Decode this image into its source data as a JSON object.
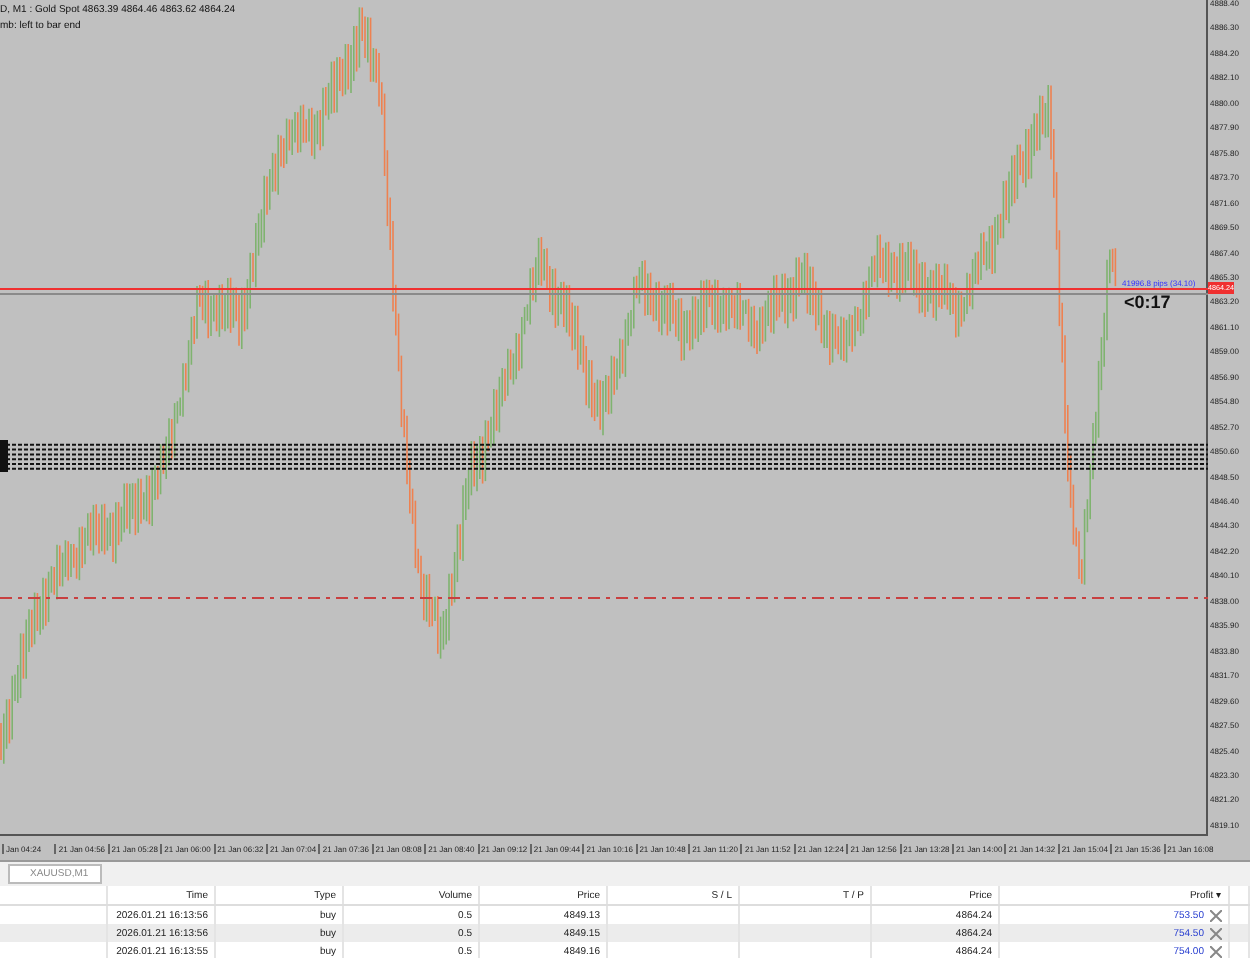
{
  "chart": {
    "header": "D, M1 : Gold Spot  4863.39 4864.46 4863.62 4864.24",
    "subheader": "mb: left to bar end",
    "price_axis": [
      "4888.40",
      "4886.30",
      "4884.20",
      "4882.10",
      "4880.00",
      "4877.90",
      "4875.80",
      "4873.70",
      "4871.60",
      "4869.50",
      "4867.40",
      "4865.30",
      "4863.20",
      "4861.10",
      "4859.00",
      "4856.90",
      "4854.80",
      "4852.70",
      "4850.60",
      "4848.50",
      "4846.40",
      "4844.30",
      "4842.20",
      "4840.10",
      "4838.00",
      "4835.90",
      "4833.80",
      "4831.70",
      "4829.60",
      "4827.50",
      "4825.40",
      "4823.30",
      "4821.20",
      "4819.10"
    ],
    "current_price": "4864.24",
    "pips_label": "41996.8 pips (34.10)",
    "timer": "<0:17",
    "time_axis": [
      "Jan 04:24",
      "21 Jan 04:56",
      "21 Jan 05:28",
      "21 Jan 06:00",
      "21 Jan 06:32",
      "21 Jan 07:04",
      "21 Jan 07:36",
      "21 Jan 08:08",
      "21 Jan 08:40",
      "21 Jan 09:12",
      "21 Jan 09:44",
      "21 Jan 10:16",
      "21 Jan 10:48",
      "21 Jan 11:20",
      "21 Jan 11:52",
      "21 Jan 12:24",
      "21 Jan 12:56",
      "21 Jan 13:28",
      "21 Jan 14:00",
      "21 Jan 14:32",
      "21 Jan 15:04",
      "21 Jan 15:36",
      "21 Jan 16:08"
    ]
  },
  "chart_tab": "XAUUSD,M1",
  "table": {
    "columns": [
      "Time",
      "Type",
      "Volume",
      "Price",
      "S / L",
      "T / P",
      "Price",
      "Profit ▾"
    ],
    "rows": [
      {
        "time": "2026.01.21 16:13:56",
        "type": "buy",
        "volume": "0.5",
        "open_price": "4849.13",
        "sl": "",
        "tp": "",
        "price": "4864.24",
        "profit": "753.50"
      },
      {
        "time": "2026.01.21 16:13:56",
        "type": "buy",
        "volume": "0.5",
        "open_price": "4849.15",
        "sl": "",
        "tp": "",
        "price": "4864.24",
        "profit": "754.50"
      },
      {
        "time": "2026.01.21 16:13:55",
        "type": "buy",
        "volume": "0.5",
        "open_price": "4849.16",
        "sl": "",
        "tp": "",
        "price": "4864.24",
        "profit": "754.00"
      }
    ]
  }
}
